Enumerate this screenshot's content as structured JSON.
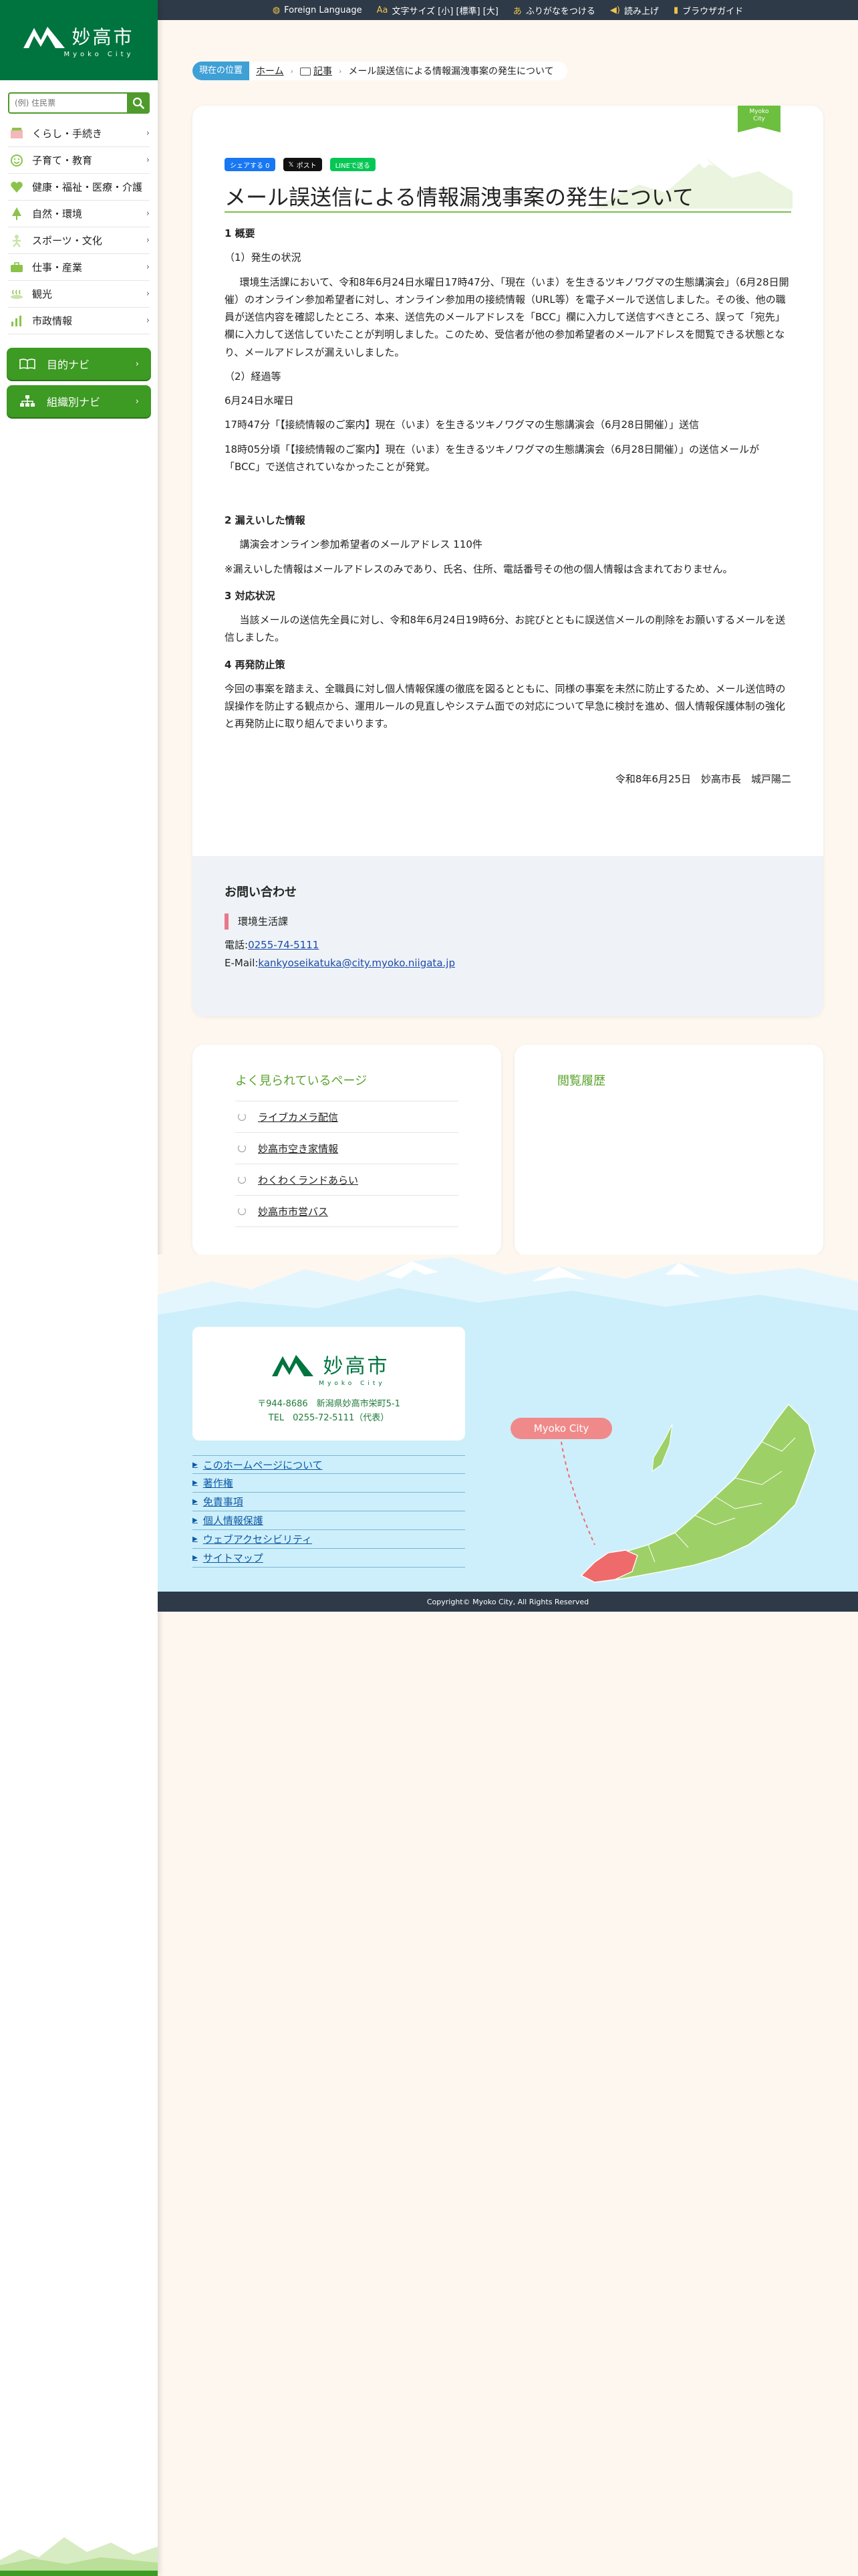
{
  "topbar": {
    "foreign_language": "Foreign Language",
    "font_size": "文字サイズ [小] [標準] [大]",
    "furigana": "ふりがなをつける",
    "read_aloud": "読み上げ",
    "browser_guide": "ブラウザガイド"
  },
  "logo": {
    "jp": "妙高市",
    "en": "Myoko City"
  },
  "search": {
    "placeholder": "(例) 住民票"
  },
  "nav": {
    "items": [
      {
        "label": "くらし・手続き",
        "icon": "house-icon"
      },
      {
        "label": "子育て・教育",
        "icon": "smiley-icon"
      },
      {
        "label": "健康・福祉・医療・介護",
        "icon": "heart-icon"
      },
      {
        "label": "自然・環境",
        "icon": "tree-icon"
      },
      {
        "label": "スポーツ・文化",
        "icon": "runner-icon"
      },
      {
        "label": "仕事・産業",
        "icon": "briefcase-icon"
      },
      {
        "label": "観光",
        "icon": "onsen-icon"
      },
      {
        "label": "市政情報",
        "icon": "chart-icon"
      }
    ],
    "purpose_navi": "目的ナビ",
    "org_navi": "組織別ナビ"
  },
  "breadcrumb": {
    "here": "現在の位置",
    "home": "ホーム",
    "articles": "記事",
    "current": "メール誤送信による情報漏洩事案の発生について"
  },
  "ribbon": {
    "line1": "Myoko",
    "line2": "City"
  },
  "share": {
    "facebook": "シェアする 0",
    "x": "ポスト",
    "line": "LINEで送る"
  },
  "article": {
    "title": "メール誤送信による情報漏洩事案の発生について",
    "h1": "1 概要",
    "s1": "（1）発生の状況",
    "p1": "環境生活課において、令和8年6月24日水曜日17時47分、「現在（いま）を生きるツキノワグマの生態講演会」（6月28日開催）のオンライン参加希望者に対し、オンライン参加用の接続情報（URL等）を電子メールで送信しました。その後、他の職員が送信内容を確認したところ、本来、送信先のメールアドレスを「BCC」欄に入力して送信すべきところ、誤って「宛先」欄に入力して送信していたことが判明しました。このため、受信者が他の参加希望者のメールアドレスを閲覧できる状態となり、メールアドレスが漏えいしました。",
    "s2": "（2）経過等",
    "p2": "6月24日水曜日",
    "p3": "17時47分「【接続情報のご案内】現在（いま）を生きるツキノワグマの生態講演会（6月28日開催）」送信",
    "p4": "18時05分頃「【接続情報のご案内】現在（いま）を生きるツキノワグマの生態講演会（6月28日開催）」の送信メールが「BCC」で送信されていなかったことが発覚。",
    "h2": "2 漏えいした情報",
    "p5": "講演会オンライン参加希望者のメールアドレス 110件",
    "p6": "※漏えいした情報はメールアドレスのみであり、氏名、住所、電話番号その他の個人情報は含まれておりません。",
    "h3": "3 対応状況",
    "p7": "当該メールの送信先全員に対し、令和8年6月24日19時6分、お詫びとともに誤送信メールの削除をお願いするメールを送信しました。",
    "h4": "4 再発防止策",
    "p8": "今回の事案を踏まえ、全職員に対し個人情報保護の徹底を図るとともに、同様の事案を未然に防止するため、メール送信時の誤操作を防止する観点から、運用ルールの見直しやシステム面での対応について早急に検討を進め、個人情報保護体制の強化と再発防止に取り組んでまいります。",
    "sign": "令和8年6月25日　妙高市長　城戸陽二"
  },
  "contact": {
    "heading": "お問い合わせ",
    "dept": "環境生活課",
    "tel_label": "電話:",
    "tel": "0255-74-5111",
    "mail_label": "E-Mail:",
    "mail": "kankyoseikatuka@city.myoko.niigata.jp"
  },
  "popular": {
    "title": "よく見られているページ",
    "items": [
      "ライブカメラ配信",
      "妙高市空き家情報",
      "わくわくランドあらい",
      "妙高市市営バス"
    ]
  },
  "history": {
    "title": "閲覧履歴"
  },
  "footer": {
    "logo_jp": "妙高市",
    "logo_en": "Myoko City",
    "address": "〒944-8686　新潟県妙高市栄町5-1",
    "tel": "TEL　0255-72-5111（代表）",
    "links": [
      "このホームページについて",
      "著作権",
      "免責事項",
      "個人情報保護",
      "ウェブアクセシビリティ",
      "サイトマップ"
    ],
    "map_label": "Myoko City",
    "copyright": "Copyright© Myoko City, All Rights Reserved"
  },
  "colors": {
    "brand_green": "#00743f",
    "accent_green": "#3d9a23",
    "link_blue": "#1a4aa8",
    "footer_sky": "#cdeffb"
  }
}
